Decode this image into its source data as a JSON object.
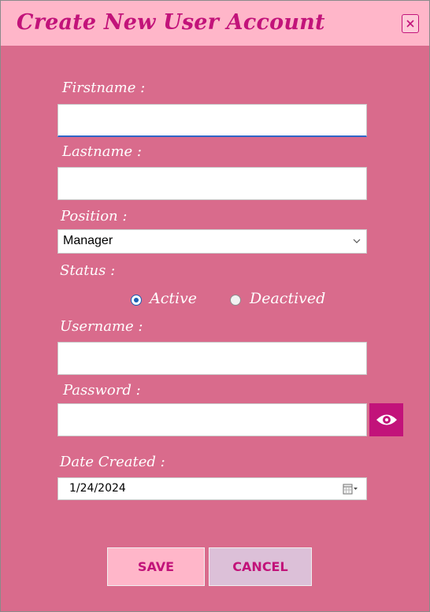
{
  "window": {
    "title": "Create New User Account",
    "close_label": "×"
  },
  "form": {
    "firstname": {
      "label": "Firstname :",
      "value": ""
    },
    "lastname": {
      "label": "Lastname :",
      "value": ""
    },
    "position": {
      "label": "Position :",
      "selected": "Manager"
    },
    "status": {
      "label": "Status :",
      "options": [
        {
          "label": "Active",
          "checked": true
        },
        {
          "label": "Deactived",
          "checked": false
        }
      ]
    },
    "username": {
      "label": "Username :",
      "value": ""
    },
    "password": {
      "label": "Password :",
      "value": ""
    },
    "date_created": {
      "label": "Date Created :",
      "value": "1/24/2024"
    }
  },
  "buttons": {
    "save": "SAVE",
    "cancel": "CANCEL"
  },
  "colors": {
    "background": "#d96b8c",
    "titlebar": "#ffb6c9",
    "accent": "#c2137a",
    "save_button": "#ffb6c9",
    "cancel_button": "#dcc0d8"
  },
  "icons": {
    "close": "close-icon",
    "dropdown": "chevron-down-icon",
    "password_toggle": "eye-icon",
    "calendar": "calendar-icon"
  }
}
